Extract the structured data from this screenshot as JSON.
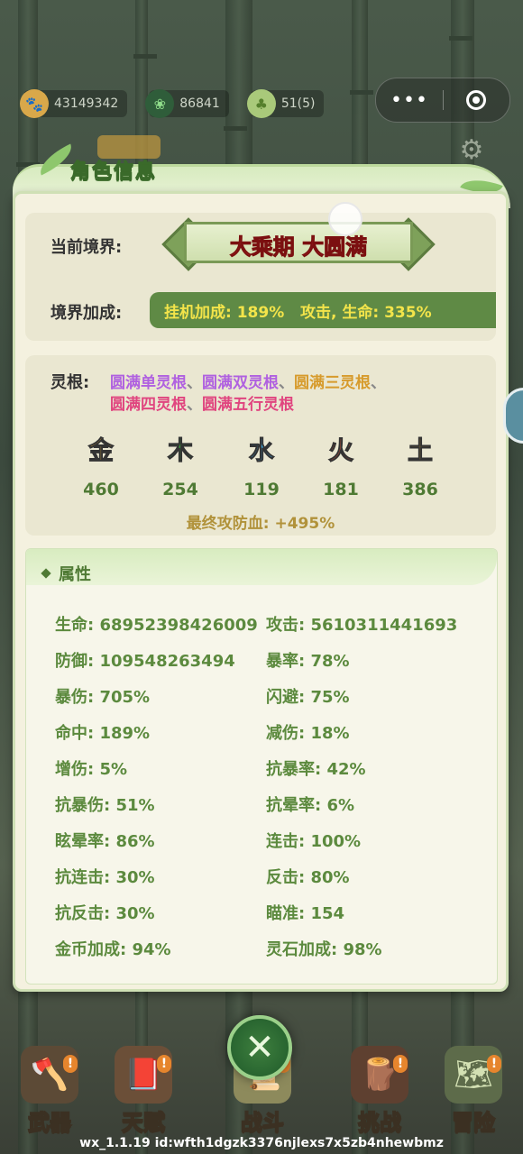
{
  "resources": [
    {
      "icon": "paw-icon",
      "value": "43149342"
    },
    {
      "icon": "herb-icon",
      "value": "86841"
    },
    {
      "icon": "bud-icon",
      "value": "51(5)"
    }
  ],
  "panel": {
    "title": "角色信息"
  },
  "realm": {
    "label": "当前境界:",
    "value": "大乘期 大圆满",
    "bonus_label": "境界加成:",
    "bonus_text": "挂机加成: 189%   攻击, 生命: 335%"
  },
  "spirit_root": {
    "label": "灵根:",
    "line1": [
      {
        "text": "圆满单灵根",
        "color": "#b061e0"
      },
      {
        "text": "、",
        "color": "#888888"
      },
      {
        "text": "圆满双灵根",
        "color": "#b061e0"
      },
      {
        "text": "、",
        "color": "#888888"
      },
      {
        "text": "圆满三灵根",
        "color": "#d79b2c"
      },
      {
        "text": "、",
        "color": "#888888"
      }
    ],
    "line2": [
      {
        "text": "圆满四灵根",
        "color": "#e0457f"
      },
      {
        "text": "、",
        "color": "#888888"
      },
      {
        "text": "圆满五行灵根",
        "color": "#e0457f"
      }
    ]
  },
  "elements": [
    {
      "name": "金",
      "value": "460",
      "color": "#e0a733"
    },
    {
      "name": "木",
      "value": "254",
      "color": "#3d9a3d"
    },
    {
      "name": "水",
      "value": "119",
      "color": "#3fa6de"
    },
    {
      "name": "火",
      "value": "181",
      "color": "#e2553b"
    },
    {
      "name": "土",
      "value": "386",
      "color": "#a88a3c"
    }
  ],
  "final_bonus": "最终攻防血: +495%",
  "attributes": {
    "title": "属性",
    "left": [
      "生命: 68952398426009",
      "防御: 109548263494",
      "暴伤: 705%",
      "命中: 189%",
      "增伤: 5%",
      "抗暴伤: 51%",
      "眩晕率: 86%",
      "抗连击: 30%",
      "抗反击: 30%",
      "金币加成: 94%"
    ],
    "right": [
      "攻击: 5610311441693",
      "暴率: 78%",
      "闪避: 75%",
      "减伤: 18%",
      "抗暴率: 42%",
      "抗晕率: 6%",
      "连击: 100%",
      "反击: 80%",
      "瞄准: 154",
      "灵石加成: 98%"
    ]
  },
  "nav": [
    {
      "label": "武器",
      "icon": "axe-icon",
      "badge": "!"
    },
    {
      "label": "天赋",
      "icon": "book-icon",
      "badge": "!"
    },
    {
      "label": "战斗",
      "icon": "scroll-icon",
      "badge": "!"
    },
    {
      "label": "挑战",
      "icon": "stump-icon",
      "badge": "!"
    },
    {
      "label": "冒险",
      "icon": "map-icon",
      "badge": "!"
    }
  ],
  "footer": "wx_1.1.19 id:wfth1dgzk3376njlexs7x5zb4nhewbmz"
}
